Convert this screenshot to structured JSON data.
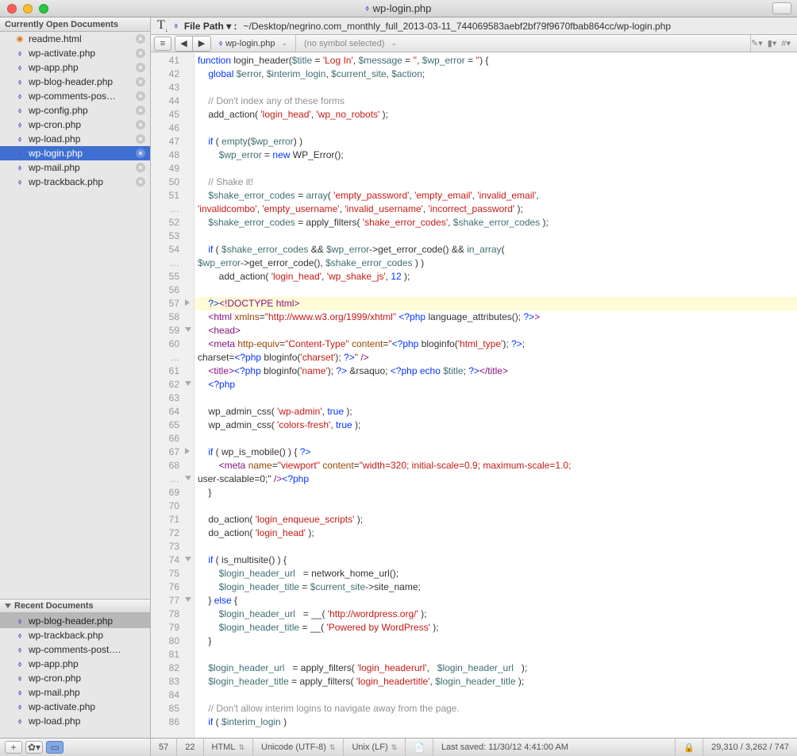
{
  "window": {
    "title": "wp-login.php"
  },
  "sidebar": {
    "open_header": "Currently Open Documents",
    "recent_header": "Recent Documents",
    "open_items": [
      {
        "name": "readme.html",
        "type": "html"
      },
      {
        "name": "wp-activate.php",
        "type": "php"
      },
      {
        "name": "wp-app.php",
        "type": "php"
      },
      {
        "name": "wp-blog-header.php",
        "type": "php"
      },
      {
        "name": "wp-comments-pos…",
        "type": "php"
      },
      {
        "name": "wp-config.php",
        "type": "php"
      },
      {
        "name": "wp-cron.php",
        "type": "php"
      },
      {
        "name": "wp-load.php",
        "type": "php"
      },
      {
        "name": "wp-login.php",
        "type": "php",
        "selected": true
      },
      {
        "name": "wp-mail.php",
        "type": "php"
      },
      {
        "name": "wp-trackback.php",
        "type": "php"
      }
    ],
    "recent_items": [
      {
        "name": "wp-blog-header.php",
        "type": "php",
        "selected": true
      },
      {
        "name": "wp-trackback.php",
        "type": "php"
      },
      {
        "name": "wp-comments-post.…",
        "type": "php"
      },
      {
        "name": "wp-app.php",
        "type": "php"
      },
      {
        "name": "wp-cron.php",
        "type": "php"
      },
      {
        "name": "wp-mail.php",
        "type": "php"
      },
      {
        "name": "wp-activate.php",
        "type": "php"
      },
      {
        "name": "wp-load.php",
        "type": "php"
      }
    ]
  },
  "pathbar": {
    "label": "File Path ▾ :",
    "value": "~/Desktop/negrino.com_monthly_full_2013-03-11_744069583aebf2bf79f9670fbab864cc/wp-login.php"
  },
  "navbar": {
    "file": "wp-login.php",
    "symbol": "(no symbol selected)"
  },
  "statusbar": {
    "line": "57",
    "col": "22",
    "lang": "HTML",
    "enc": "Unicode (UTF-8)",
    "eol": "Unix (LF)",
    "saved": "Last saved: 11/30/12 4:41:00 AM",
    "stats": "29,310 / 3,262 / 747"
  },
  "code": {
    "lines": [
      {
        "n": "41",
        "html": "<span class='kw'>function</span> login_header(<span class='var'>$title</span> = <span class='str'>'Log In'</span>, <span class='var'>$message</span> = <span class='str'>''</span>, <span class='var'>$wp_error</span> = <span class='str'>''</span>) {"
      },
      {
        "n": "42",
        "html": "    <span class='kw'>global</span> <span class='var'>$error</span>, <span class='var'>$interim_login</span>, <span class='var'>$current_site</span>, <span class='var'>$action</span>;"
      },
      {
        "n": "43",
        "html": " "
      },
      {
        "n": "44",
        "html": "    <span class='com'>// Don't index any of these forms</span>"
      },
      {
        "n": "45",
        "html": "    add_action( <span class='str'>'login_head'</span>, <span class='str'>'wp_no_robots'</span> );"
      },
      {
        "n": "46",
        "html": " "
      },
      {
        "n": "47",
        "html": "    <span class='kw'>if</span> ( <span class='fn'>empty</span>(<span class='var'>$wp_error</span>) )"
      },
      {
        "n": "48",
        "html": "        <span class='var'>$wp_error</span> = <span class='kw'>new</span> WP_Error();"
      },
      {
        "n": "49",
        "html": " "
      },
      {
        "n": "50",
        "html": "    <span class='com'>// Shake it!</span>"
      },
      {
        "n": "51",
        "html": "    <span class='var'>$shake_error_codes</span> = <span class='fn'>array</span>( <span class='str'>'empty_password'</span>, <span class='str'>'empty_email'</span>, <span class='str'>'invalid_email'</span>, "
      },
      {
        "n": "…",
        "html": "<span class='str'>'invalidcombo'</span>, <span class='str'>'empty_username'</span>, <span class='str'>'invalid_username'</span>, <span class='str'>'incorrect_password'</span> );"
      },
      {
        "n": "52",
        "html": "    <span class='var'>$shake_error_codes</span> = apply_filters( <span class='str'>'shake_error_codes'</span>, <span class='var'>$shake_error_codes</span> );"
      },
      {
        "n": "53",
        "html": " "
      },
      {
        "n": "54",
        "html": "    <span class='kw'>if</span> ( <span class='var'>$shake_error_codes</span> &amp;&amp; <span class='var'>$wp_error</span>-&gt;get_error_code() &amp;&amp; <span class='fn'>in_array</span>( "
      },
      {
        "n": "…",
        "html": "<span class='var'>$wp_error</span>-&gt;get_error_code(), <span class='var'>$shake_error_codes</span> ) )"
      },
      {
        "n": "55",
        "html": "        add_action( <span class='str'>'login_head'</span>, <span class='str'>'wp_shake_js'</span>, <span class='num'>12</span> );"
      },
      {
        "n": "56",
        "html": " "
      },
      {
        "n": "57",
        "html": "    <span class='php'>?&gt;</span><span class='tag'>&lt;!DOCTYPE html&gt;</span>",
        "hl": true,
        "foldr": true
      },
      {
        "n": "58",
        "html": "    <span class='tag'>&lt;html</span> <span class='attr'>xmlns</span>=<span class='str'>\"http://www.w3.org/1999/xhtml\"</span> <span class='php'>&lt;?php</span> language_attributes(); <span class='php'>?&gt;</span><span class='tag'>&gt;</span>"
      },
      {
        "n": "59",
        "html": "    <span class='tag'>&lt;head&gt;</span>",
        "fold": true
      },
      {
        "n": "60",
        "html": "    <span class='tag'>&lt;meta</span> <span class='attr'>http-equiv</span>=<span class='str'>\"Content-Type\"</span> <span class='attr'>content</span>=<span class='str'>\"</span><span class='php'>&lt;?php</span> bloginfo(<span class='str'>'html_type'</span>); <span class='php'>?&gt;</span>; "
      },
      {
        "n": "…",
        "html": "charset=<span class='php'>&lt;?php</span> bloginfo(<span class='str'>'charset'</span>); <span class='php'>?&gt;</span><span class='str'>\"</span> <span class='tag'>/&gt;</span>"
      },
      {
        "n": "61",
        "html": "    <span class='tag'>&lt;title&gt;</span><span class='php'>&lt;?php</span> bloginfo(<span class='str'>'name'</span>); <span class='php'>?&gt;</span> &amp;rsaquo; <span class='php'>&lt;?php</span> <span class='kw'>echo</span> <span class='var'>$title</span>; <span class='php'>?&gt;</span><span class='tag'>&lt;/title&gt;</span>"
      },
      {
        "n": "62",
        "html": "    <span class='php'>&lt;?php</span>",
        "fold": true
      },
      {
        "n": "63",
        "html": " "
      },
      {
        "n": "64",
        "html": "    wp_admin_css( <span class='str'>'wp-admin'</span>, <span class='kw'>true</span> );"
      },
      {
        "n": "65",
        "html": "    wp_admin_css( <span class='str'>'colors-fresh'</span>, <span class='kw'>true</span> );"
      },
      {
        "n": "66",
        "html": " "
      },
      {
        "n": "67",
        "html": "    <span class='kw'>if</span> ( wp_is_mobile() ) { <span class='php'>?&gt;</span>",
        "foldr": true
      },
      {
        "n": "68",
        "html": "        <span class='tag'>&lt;meta</span> <span class='attr'>name</span>=<span class='str'>\"viewport\"</span> <span class='attr'>content</span>=<span class='str'>\"width=320; initial-scale=0.9; maximum-scale=1.0; "
      },
      {
        "n": "…",
        "html": "user-scalable=0;\"</span> <span class='tag'>/&gt;</span><span class='php'>&lt;?php</span>",
        "fold": true
      },
      {
        "n": "69",
        "html": "    }"
      },
      {
        "n": "70",
        "html": " "
      },
      {
        "n": "71",
        "html": "    do_action( <span class='str'>'login_enqueue_scripts'</span> );"
      },
      {
        "n": "72",
        "html": "    do_action( <span class='str'>'login_head'</span> );"
      },
      {
        "n": "73",
        "html": " "
      },
      {
        "n": "74",
        "html": "    <span class='kw'>if</span> ( is_multisite() ) {",
        "fold": true
      },
      {
        "n": "75",
        "html": "        <span class='var'>$login_header_url</span>   = network_home_url();"
      },
      {
        "n": "76",
        "html": "        <span class='var'>$login_header_title</span> = <span class='var'>$current_site</span>-&gt;site_name;"
      },
      {
        "n": "77",
        "html": "    } <span class='kw'>else</span> {",
        "fold": true
      },
      {
        "n": "78",
        "html": "        <span class='var'>$login_header_url</span>   = __( <span class='str'>'http://wordpress.org/'</span> );"
      },
      {
        "n": "79",
        "html": "        <span class='var'>$login_header_title</span> = __( <span class='str'>'Powered by WordPress'</span> );"
      },
      {
        "n": "80",
        "html": "    }"
      },
      {
        "n": "81",
        "html": " "
      },
      {
        "n": "82",
        "html": "    <span class='var'>$login_header_url</span>   = apply_filters( <span class='str'>'login_headerurl'</span>,   <span class='var'>$login_header_url</span>   );"
      },
      {
        "n": "83",
        "html": "    <span class='var'>$login_header_title</span> = apply_filters( <span class='str'>'login_headertitle'</span>, <span class='var'>$login_header_title</span> );"
      },
      {
        "n": "84",
        "html": " "
      },
      {
        "n": "85",
        "html": "    <span class='com'>// Don't allow interim logins to navigate away from the page.</span>"
      },
      {
        "n": "86",
        "html": "    <span class='kw'>if</span> ( <span class='var'>$interim_login</span> )"
      }
    ]
  }
}
